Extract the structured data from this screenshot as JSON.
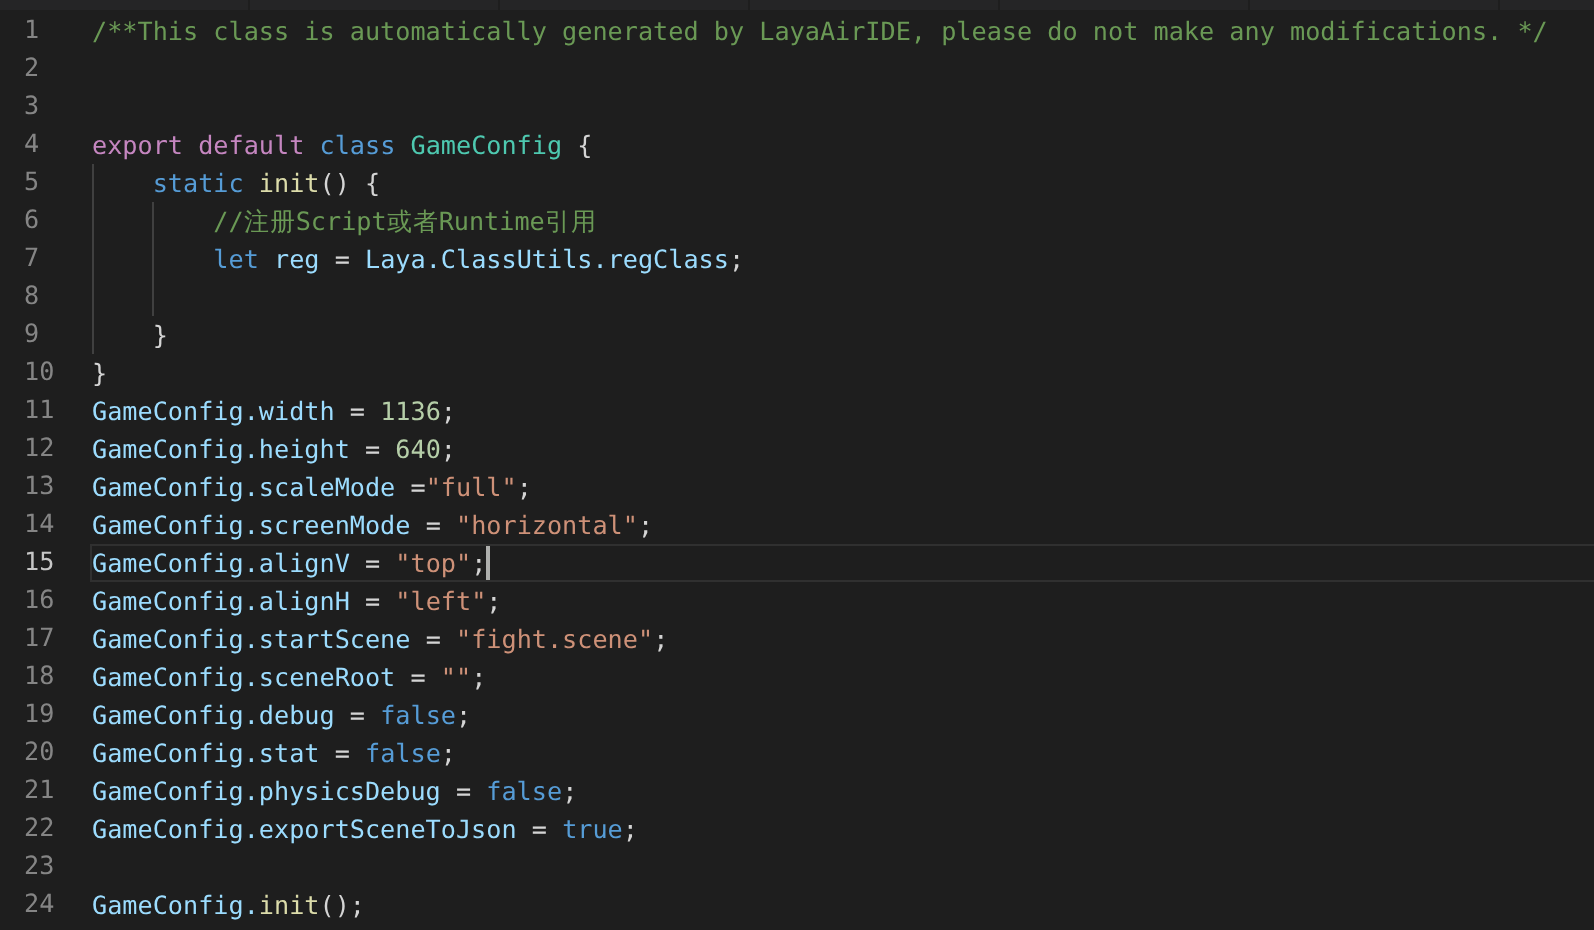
{
  "editor": {
    "lines": [
      {
        "number": "1",
        "current": false,
        "tokens": [
          {
            "text": "/**This class is automatically generated by LayaAirIDE, please do not make any modifications. */",
            "kind": "comment"
          }
        ]
      },
      {
        "number": "2",
        "current": false
      },
      {
        "number": "3",
        "current": false
      },
      {
        "number": "4",
        "current": false,
        "tokens": [
          {
            "text": "export default ",
            "kind": "keyword"
          },
          {
            "text": "class ",
            "kind": "storage"
          },
          {
            "text": "GameConfig",
            "kind": "class"
          },
          {
            "text": " {",
            "kind": "plain"
          }
        ]
      },
      {
        "number": "5",
        "current": false,
        "tokens": [
          {
            "text": "    static ",
            "kind": "storage"
          },
          {
            "text": "init",
            "kind": "function"
          },
          {
            "text": "() {",
            "kind": "plain"
          }
        ]
      },
      {
        "number": "6",
        "current": false,
        "tokens": [
          {
            "text": "        //注册Script或者Runtime引用",
            "kind": "comment"
          }
        ]
      },
      {
        "number": "7",
        "current": false,
        "tokens": [
          {
            "text": "        let ",
            "kind": "storage"
          },
          {
            "text": "reg",
            "kind": "variable"
          },
          {
            "text": " = ",
            "kind": "plain"
          },
          {
            "text": "Laya.ClassUtils.regClass",
            "kind": "variable"
          },
          {
            "text": ";",
            "kind": "plain"
          }
        ]
      },
      {
        "number": "8",
        "current": false
      },
      {
        "number": "9",
        "current": false,
        "tokens": [
          {
            "text": "    }",
            "kind": "plain"
          }
        ]
      },
      {
        "number": "10",
        "current": false,
        "tokens": [
          {
            "text": "}",
            "kind": "plain"
          }
        ]
      },
      {
        "number": "11",
        "current": false,
        "tokens": [
          {
            "text": "GameConfig.width",
            "kind": "variable"
          },
          {
            "text": " = ",
            "kind": "plain"
          },
          {
            "text": "1136",
            "kind": "number"
          },
          {
            "text": ";",
            "kind": "plain"
          }
        ]
      },
      {
        "number": "12",
        "current": false,
        "tokens": [
          {
            "text": "GameConfig.height",
            "kind": "variable"
          },
          {
            "text": " = ",
            "kind": "plain"
          },
          {
            "text": "640",
            "kind": "number"
          },
          {
            "text": ";",
            "kind": "plain"
          }
        ]
      },
      {
        "number": "13",
        "current": false,
        "tokens": [
          {
            "text": "GameConfig.scaleMode",
            "kind": "variable"
          },
          {
            "text": " =",
            "kind": "plain"
          },
          {
            "text": "\"full\"",
            "kind": "string"
          },
          {
            "text": ";",
            "kind": "plain"
          }
        ]
      },
      {
        "number": "14",
        "current": false,
        "tokens": [
          {
            "text": "GameConfig.screenMode",
            "kind": "variable"
          },
          {
            "text": " = ",
            "kind": "plain"
          },
          {
            "text": "\"horizontal\"",
            "kind": "string"
          },
          {
            "text": ";",
            "kind": "plain"
          }
        ]
      },
      {
        "number": "15",
        "current": true,
        "tokens": [
          {
            "text": "GameConfig.alignV",
            "kind": "variable"
          },
          {
            "text": " = ",
            "kind": "plain"
          },
          {
            "text": "\"top\"",
            "kind": "string"
          },
          {
            "text": ";",
            "kind": "plain"
          }
        ]
      },
      {
        "number": "16",
        "current": false,
        "tokens": [
          {
            "text": "GameConfig.alignH",
            "kind": "variable"
          },
          {
            "text": " = ",
            "kind": "plain"
          },
          {
            "text": "\"left\"",
            "kind": "string"
          },
          {
            "text": ";",
            "kind": "plain"
          }
        ]
      },
      {
        "number": "17",
        "current": false,
        "tokens": [
          {
            "text": "GameConfig.startScene",
            "kind": "variable"
          },
          {
            "text": " = ",
            "kind": "plain"
          },
          {
            "text": "\"fight.scene\"",
            "kind": "string"
          },
          {
            "text": ";",
            "kind": "plain"
          }
        ]
      },
      {
        "number": "18",
        "current": false,
        "tokens": [
          {
            "text": "GameConfig.sceneRoot",
            "kind": "variable"
          },
          {
            "text": " = ",
            "kind": "plain"
          },
          {
            "text": "\"\"",
            "kind": "string"
          },
          {
            "text": ";",
            "kind": "plain"
          }
        ]
      },
      {
        "number": "19",
        "current": false,
        "tokens": [
          {
            "text": "GameConfig.debug",
            "kind": "variable"
          },
          {
            "text": " = ",
            "kind": "plain"
          },
          {
            "text": "false",
            "kind": "storage"
          },
          {
            "text": ";",
            "kind": "plain"
          }
        ]
      },
      {
        "number": "20",
        "current": false,
        "tokens": [
          {
            "text": "GameConfig.stat",
            "kind": "variable"
          },
          {
            "text": " = ",
            "kind": "plain"
          },
          {
            "text": "false",
            "kind": "storage"
          },
          {
            "text": ";",
            "kind": "plain"
          }
        ]
      },
      {
        "number": "21",
        "current": false,
        "tokens": [
          {
            "text": "GameConfig.physicsDebug",
            "kind": "variable"
          },
          {
            "text": " = ",
            "kind": "plain"
          },
          {
            "text": "false",
            "kind": "storage"
          },
          {
            "text": ";",
            "kind": "plain"
          }
        ]
      },
      {
        "number": "22",
        "current": false,
        "tokens": [
          {
            "text": "GameConfig.exportSceneToJson",
            "kind": "variable"
          },
          {
            "text": " = ",
            "kind": "plain"
          },
          {
            "text": "true",
            "kind": "storage"
          },
          {
            "text": ";",
            "kind": "plain"
          }
        ]
      },
      {
        "number": "23",
        "current": false
      },
      {
        "number": "24",
        "current": false,
        "tokens": [
          {
            "text": "GameConfig.",
            "kind": "variable"
          },
          {
            "text": "init",
            "kind": "function"
          },
          {
            "text": "();",
            "kind": "plain"
          }
        ]
      }
    ]
  }
}
